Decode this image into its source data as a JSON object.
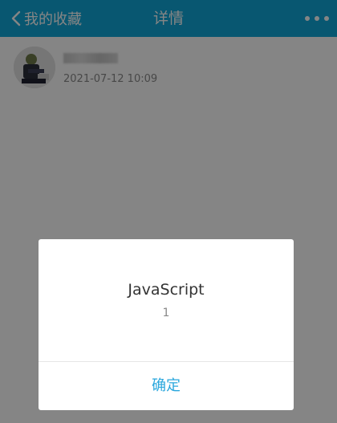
{
  "header": {
    "back_label": "我的收藏",
    "title": "详情",
    "back_icon": "chevron-left-icon",
    "more_icon": "more-dots-icon"
  },
  "post": {
    "timestamp": "2021-07-12 10:09"
  },
  "dialog": {
    "title": "JavaScript",
    "message": "1",
    "confirm_label": "确定"
  },
  "colors": {
    "header_bg": "#11a7d8",
    "accent": "#2aa7dd",
    "overlay": "rgba(0,0,0,0.48)"
  }
}
